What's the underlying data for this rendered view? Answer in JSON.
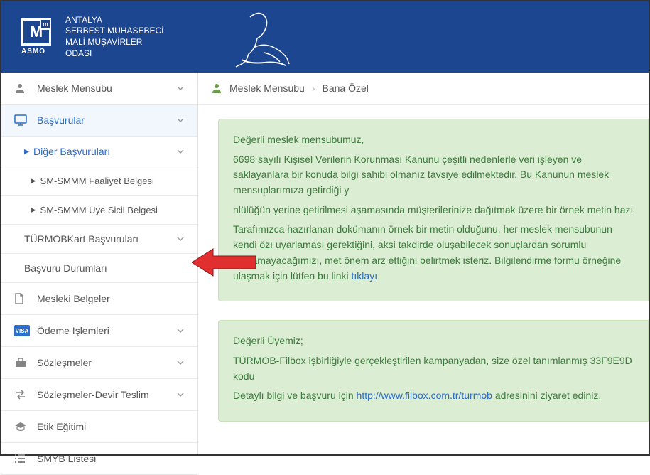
{
  "header": {
    "org_lines": [
      "ANTALYA",
      "SERBEST MUHASEBECİ",
      "MALİ MÜŞAVİRLER",
      "ODASI"
    ],
    "logo_small": "ASMO"
  },
  "sidebar": {
    "items": [
      {
        "id": "meslek-mensubu",
        "label": "Meslek Mensubu",
        "icon": "user",
        "expandable": true
      },
      {
        "id": "basvurular",
        "label": "Başvurular",
        "icon": "monitor",
        "expandable": true,
        "active": true,
        "children": [
          {
            "id": "diger-basvurulari",
            "label": "Diğer Başvuruları",
            "expandable": true,
            "active": true,
            "children": [
              {
                "id": "faaliyet-belgesi",
                "label": "SM-SMMM Faaliyet Belgesi"
              },
              {
                "id": "uye-sicil-belgesi",
                "label": "SM-SMMM Üye Sicil Belgesi"
              }
            ]
          },
          {
            "id": "turmobkart",
            "label": "TÜRMOBKart Başvuruları",
            "expandable": true
          },
          {
            "id": "basvuru-durumlari",
            "label": "Başvuru Durumları",
            "expandable": false
          }
        ]
      },
      {
        "id": "mesleki-belgeler",
        "label": "Mesleki Belgeler",
        "icon": "file",
        "expandable": false
      },
      {
        "id": "odeme-islemleri",
        "label": "Ödeme İşlemleri",
        "icon": "visa",
        "expandable": true
      },
      {
        "id": "sozlesmeler",
        "label": "Sözleşmeler",
        "icon": "briefcase",
        "expandable": true
      },
      {
        "id": "sozlesmeler-devir",
        "label": "Sözleşmeler-Devir Teslim",
        "icon": "transfer",
        "expandable": true
      },
      {
        "id": "etik-egitimi",
        "label": "Etik Eğitimi",
        "icon": "graduation",
        "expandable": false
      },
      {
        "id": "smyb-listesi",
        "label": "SMYB Listesi",
        "icon": "list",
        "expandable": false
      }
    ]
  },
  "breadcrumb": {
    "a": "Meslek Mensubu",
    "b": "Bana Özel"
  },
  "panels": {
    "p1": {
      "greeting": "Değerli meslek mensubumuz,",
      "line1": "6698 sayılı Kişisel Verilerin Korunması Kanunu çeşitli nedenlerle veri işleyen ve saklayanlara bir konuda bilgi sahibi olmanız tavsiye edilmektedir. Bu Kanunun meslek mensuplarımıza getirdiği y",
      "line2_prefix": "",
      "line2_highlight": "nlülüğün yerine getirilmesi aşamasında müşterilerinize dağıtmak üzere bir örnek metin hazı",
      "line3": "Tarafımızca hazırlanan dokümanın örnek bir metin olduğunu, her meslek mensubunun kendi özı uyarlaması gerektiğini, aksi takdirde oluşabilecek sonuçlardan sorumlu tutulamayacağımızı, met önem arz ettiğini belirtmek isteriz. Bilgilendirme formu örneğine ulaşmak için lütfen bu linki",
      "link_text": "tıklayı"
    },
    "p2": {
      "greeting": "Değerli Üyemiz;",
      "line1": "TÜRMOB-Filbox işbirliğiyle gerçekleştirilen kampanyadan, size özel tanımlanmış 33F9E9D kodu",
      "line2_prefix": "Detaylı bilgi ve başvuru için ",
      "link": "http://www.filbox.com.tr/turmob",
      "line2_suffix": " adresinini ziyaret ediniz."
    }
  }
}
